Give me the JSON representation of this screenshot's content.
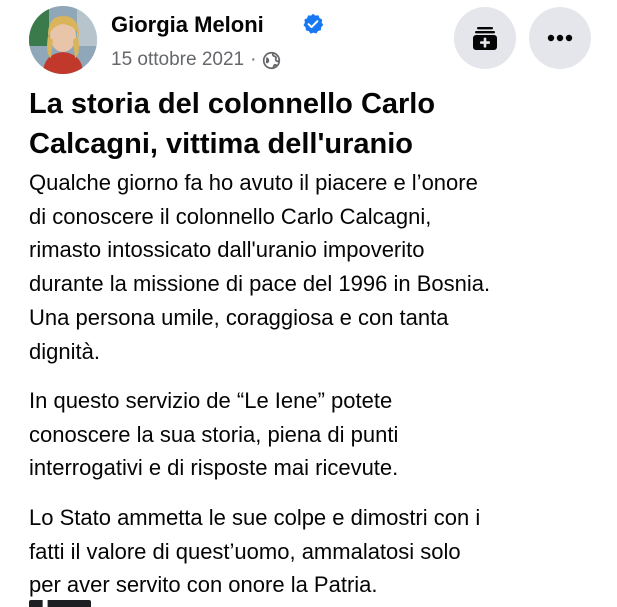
{
  "post": {
    "author": {
      "name": "Giorgia Meloni",
      "verified": true,
      "avatar_icon": "profile-photo",
      "verified_icon": "verified-badge-icon",
      "verified_color": "#1877f2"
    },
    "meta": {
      "date": "15 ottobre 2021",
      "separator": "·",
      "audience_icon": "globe-icon"
    },
    "actions": {
      "save_icon": "save-to-collection-icon",
      "more_icon": "more-options-icon",
      "button_bg": "#e4e6eb"
    },
    "title_lines": [
      "La storia del colonnello Carlo",
      "Calcagni, vittima dell'uranio"
    ],
    "paragraphs": [
      {
        "lines": [
          "Qualche giorno fa ho avuto il piacere e l’onore",
          "di conoscere il colonnello Carlo Calcagni,",
          "rimasto intossicato dall'uranio impoverito",
          "durante la missione di pace del 1996 in Bosnia.",
          "Una persona umile, coraggiosa e con tanta",
          "dignità."
        ]
      },
      {
        "lines": [
          "In questo servizio de “Le Iene” potete",
          "conoscere la sua storia, piena di punti",
          "interrogativi e di risposte mai ricevute."
        ]
      },
      {
        "lines": [
          "Lo Stato ammetta le sue colpe e dimostri con i",
          "fatti il valore di quest’uomo, ammalatosi solo",
          "per aver servito con onore la Patria."
        ]
      }
    ],
    "colors": {
      "text": "#050505",
      "secondary_text": "#65676b"
    }
  }
}
